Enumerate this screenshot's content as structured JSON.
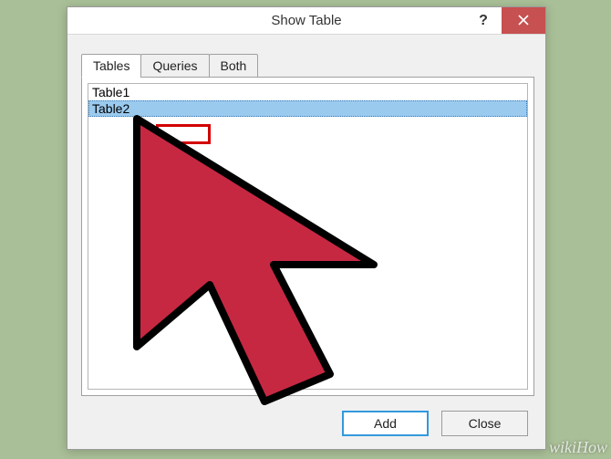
{
  "dialog": {
    "title": "Show Table",
    "help_label": "?",
    "tabs": [
      {
        "label": "Tables",
        "active": true
      },
      {
        "label": "Queries",
        "active": false
      },
      {
        "label": "Both",
        "active": false
      }
    ],
    "list_items": [
      "Table1",
      "Table2"
    ],
    "selected_index": 1,
    "buttons": {
      "add": "Add",
      "close": "Close"
    }
  },
  "annotation": {
    "highlight_item": "Table2",
    "watermark": "wikiHow"
  }
}
